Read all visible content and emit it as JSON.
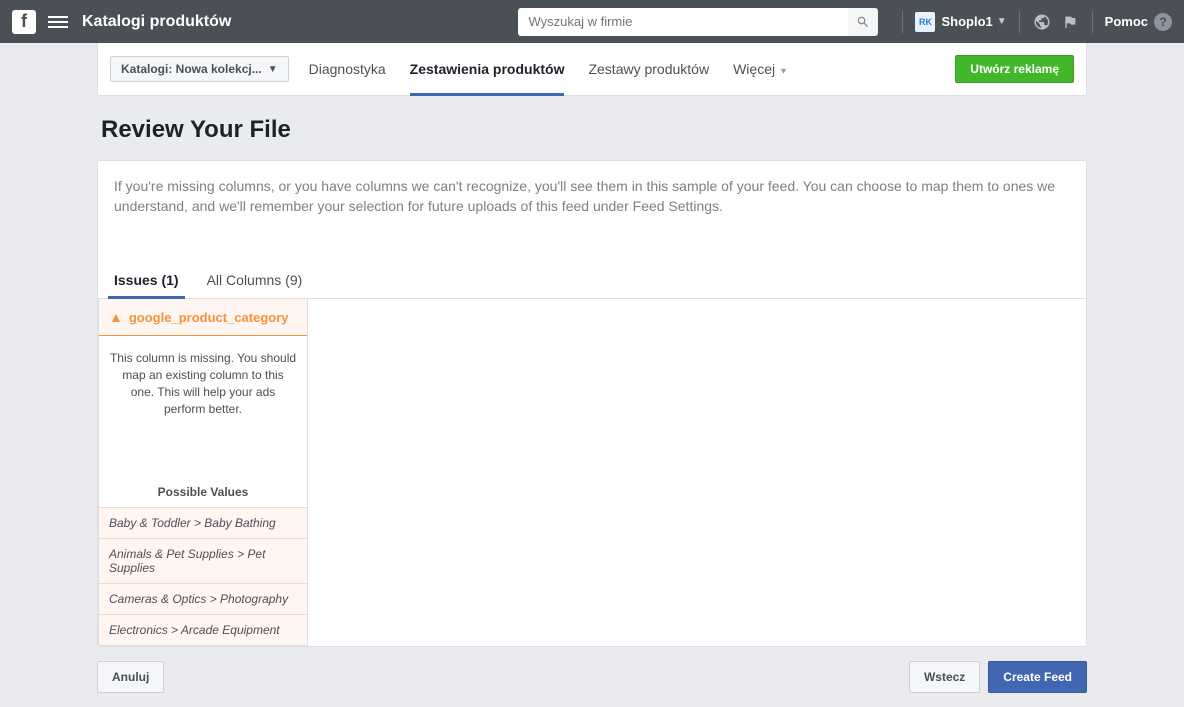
{
  "topbar": {
    "title": "Katalogi produktów",
    "search_placeholder": "Wyszukaj w firmie",
    "user_initials": "RK",
    "user_name": "Shoplo1",
    "help_label": "Pomoc"
  },
  "nav": {
    "catalog_dropdown": "Katalogi: Nowa kolekcj...",
    "tabs": {
      "diagnostyka": "Diagnostyka",
      "zestawienia": "Zestawienia produktów",
      "zestawy": "Zestawy produktów",
      "wiecej": "Więcej"
    },
    "create_ad": "Utwórz reklamę"
  },
  "page": {
    "title": "Review Your File",
    "info": "If you're missing columns, or you have columns we can't recognize, you'll see them in this sample of your feed. You can choose to map them to ones we understand, and we'll remember your selection for future uploads of this feed under Feed Settings."
  },
  "tabs": {
    "issues": "Issues (1)",
    "all_columns": "All Columns (9)"
  },
  "issue": {
    "column_name": "google_product_category",
    "message": "This column is missing. You should map an existing column to this one. This will help your ads perform better.",
    "possible_header": "Possible Values",
    "values": [
      "Baby & Toddler > Baby Bathing",
      "Animals & Pet Supplies > Pet Supplies",
      "Cameras & Optics > Photography",
      "Electronics > Arcade Equipment"
    ]
  },
  "footer": {
    "cancel": "Anuluj",
    "back": "Wstecz",
    "create": "Create Feed"
  }
}
